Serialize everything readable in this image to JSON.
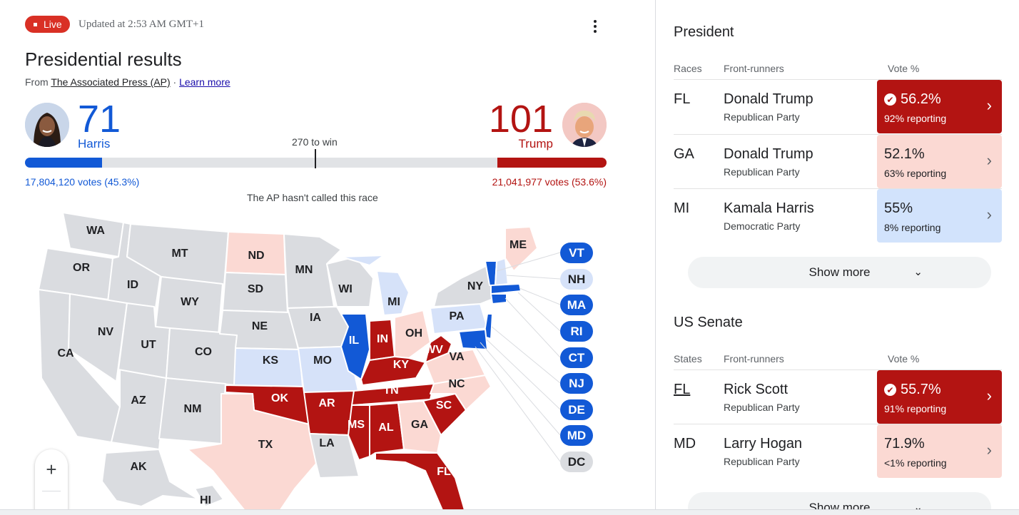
{
  "header": {
    "live_label": "Live",
    "updated": "Updated at 2:53 AM GMT+1",
    "title": "Presidential results",
    "source_prefix": "From ",
    "source_link": "The Associated Press (AP)",
    "source_sep": " · ",
    "learn_more": "Learn more"
  },
  "candidates": {
    "harris": {
      "name": "Harris",
      "electoral_votes": "71",
      "votes": "17,804,120 votes (45.3%)",
      "color": "#1259d6"
    },
    "trump": {
      "name": "Trump",
      "electoral_votes": "101",
      "votes": "21,041,977 votes (53.6%)",
      "color": "#b31412"
    }
  },
  "progress": {
    "harris_ev": 71,
    "trump_ev": 101,
    "total_ev": 538
  },
  "threshold_label": "270 to win",
  "race_status": "The AP hasn't called this race",
  "map": {
    "colors": {
      "dem_called": "#1259d6",
      "dem_lean": "#d6e2f9",
      "rep_called": "#b31412",
      "rep_lean": "#fbd9d3",
      "none": "#dadce0"
    },
    "states": [
      "WA",
      "OR",
      "CA",
      "ID",
      "NV",
      "AZ",
      "MT",
      "WY",
      "UT",
      "CO",
      "NM",
      "ND",
      "SD",
      "NE",
      "KS",
      "OK",
      "TX",
      "MN",
      "IA",
      "MO",
      "AR",
      "LA",
      "WI",
      "IL",
      "MI",
      "IN",
      "OH",
      "KY",
      "TN",
      "MS",
      "AL",
      "GA",
      "FL",
      "SC",
      "NC",
      "VA",
      "WV",
      "PA",
      "NY",
      "ME",
      "AK",
      "HI"
    ],
    "small_states": [
      {
        "code": "VT",
        "status": "dem_called"
      },
      {
        "code": "NH",
        "status": "dem_lean"
      },
      {
        "code": "MA",
        "status": "dem_called"
      },
      {
        "code": "RI",
        "status": "dem_called"
      },
      {
        "code": "CT",
        "status": "dem_called"
      },
      {
        "code": "NJ",
        "status": "dem_called"
      },
      {
        "code": "DE",
        "status": "dem_called"
      },
      {
        "code": "MD",
        "status": "dem_called"
      },
      {
        "code": "DC",
        "status": "none"
      }
    ],
    "zoom_in": "+"
  },
  "president": {
    "title": "President",
    "col_races": "Races",
    "col_front": "Front-runners",
    "col_vote": "Vote %",
    "rows": [
      {
        "code": "FL",
        "candidate": "Donald Trump",
        "party": "Republican Party",
        "pct": "56.2%",
        "reporting": "92% reporting",
        "called": true
      },
      {
        "code": "GA",
        "candidate": "Donald Trump",
        "party": "Republican Party",
        "pct": "52.1%",
        "reporting": "63% reporting",
        "called": false
      },
      {
        "code": "MI",
        "candidate": "Kamala Harris",
        "party": "Democratic Party",
        "pct": "55%",
        "reporting": "8% reporting",
        "called": false
      }
    ],
    "show_more": "Show more"
  },
  "senate": {
    "title": "US Senate",
    "col_states": "States",
    "col_front": "Front-runners",
    "col_vote": "Vote %",
    "rows": [
      {
        "code": "FL",
        "candidate": "Rick Scott",
        "party": "Republican Party",
        "pct": "55.7%",
        "reporting": "91% reporting",
        "called": true
      },
      {
        "code": "MD",
        "candidate": "Larry Hogan",
        "party": "Republican Party",
        "pct": "71.9%",
        "reporting": "<1% reporting",
        "called": false
      }
    ],
    "show_more": "Show more"
  },
  "icons": {
    "check": "✔",
    "chevron_right": "›",
    "chevron_down": "⌄"
  }
}
